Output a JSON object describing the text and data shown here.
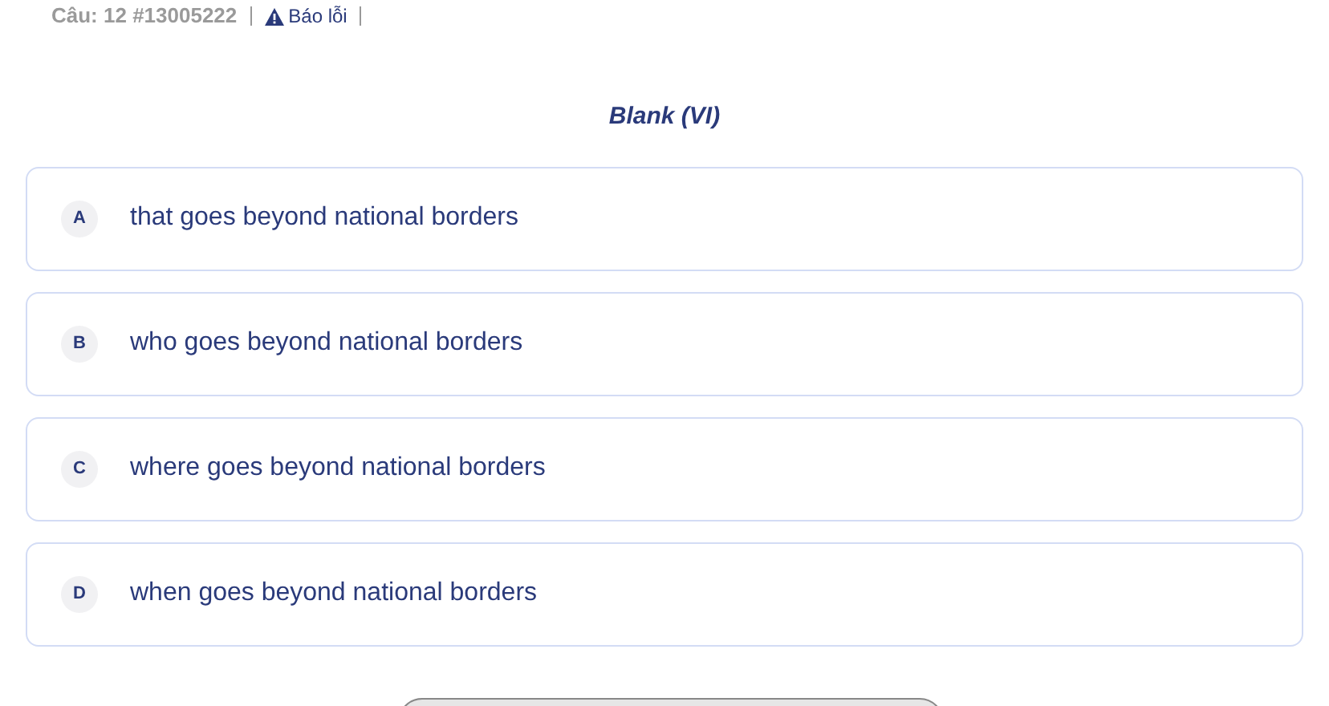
{
  "header": {
    "question": "Câu: 12 #13005222",
    "report": "Báo lỗi"
  },
  "prompt": "Blank (VI)",
  "options": [
    {
      "letter": "A",
      "text": "that goes beyond national borders"
    },
    {
      "letter": "B",
      "text": "who goes beyond national borders"
    },
    {
      "letter": "C",
      "text": "where goes beyond national borders"
    },
    {
      "letter": "D",
      "text": "when goes beyond national borders"
    }
  ]
}
